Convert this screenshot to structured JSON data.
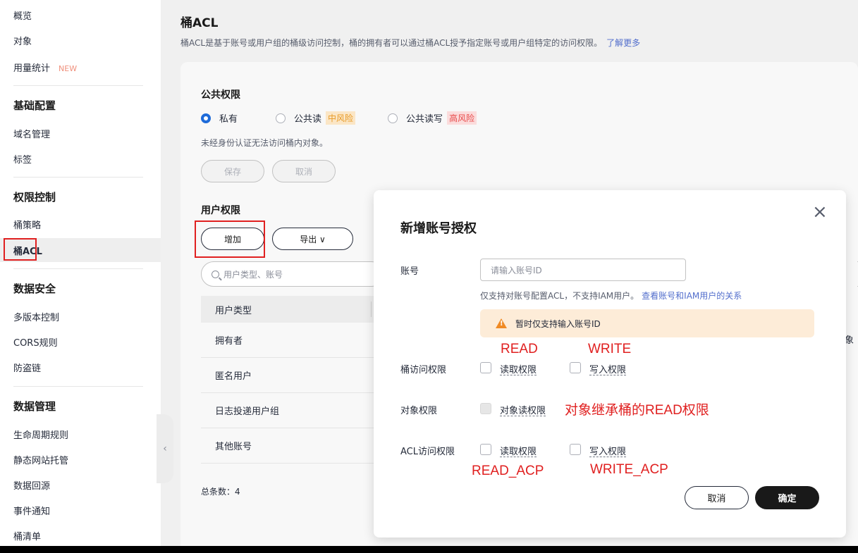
{
  "sidebar": {
    "items": [
      {
        "label": "概览"
      },
      {
        "label": "对象"
      },
      {
        "label": "用量统计",
        "badge": "NEW"
      }
    ],
    "groups": [
      {
        "title": "基础配置",
        "items": [
          "域名管理",
          "标签"
        ]
      },
      {
        "title": "权限控制",
        "items": [
          "桶策略",
          "桶ACL"
        ]
      },
      {
        "title": "数据安全",
        "items": [
          "多版本控制",
          "CORS规则",
          "防盗链"
        ]
      },
      {
        "title": "数据管理",
        "items": [
          "生命周期规则",
          "静态网站托管",
          "数据回源",
          "事件通知",
          "桶清单"
        ]
      }
    ],
    "active_item": "桶ACL",
    "collapse_icon": "‹"
  },
  "main": {
    "title": "桶ACL",
    "description": "桶ACL是基于账号或用户组的桶级访问控制，桶的拥有者可以通过桶ACL授予指定账号或用户组特定的访问权限。",
    "learn_more": "了解更多",
    "public": {
      "title": "公共权限",
      "options": [
        {
          "label": "私有",
          "checked": true
        },
        {
          "label": "公共读",
          "risk": "中风险"
        },
        {
          "label": "公共读写",
          "risk": "高风险"
        }
      ],
      "hint": "未经身份认证无法访问桶内对象。",
      "save_label": "保存",
      "cancel_label": "取消"
    },
    "user": {
      "title": "用户权限",
      "add_label": "增加",
      "export_label": "导出 ∨",
      "search_placeholder": "用户类型、账号",
      "column_header": "用户类型",
      "rows": [
        "拥有者",
        "匿名用户",
        "日志投递用户组",
        "其他账号"
      ],
      "right_edge_text": "象",
      "total": "总条数：4"
    }
  },
  "dialog": {
    "title": "新增账号授权",
    "close_icon": "×",
    "account_label": "账号",
    "account_placeholder": "请输入账号ID",
    "note": "仅支持对账号配置ACL，不支持IAM用户。",
    "note_link": "查看账号和IAM用户的关系",
    "warning": "暂时仅支持输入账号ID",
    "bucket_perm_label": "桶访问权限",
    "object_perm_label": "对象权限",
    "acl_perm_label": "ACL访问权限",
    "read_label": "读取权限",
    "write_label": "写入权限",
    "object_read_label": "对象读权限",
    "cancel_label": "取消",
    "ok_label": "确定"
  },
  "annotations": {
    "read": "READ",
    "write": "WRITE",
    "object_inherit": "对象继承桶的READ权限",
    "read_acp": "READ_ACP",
    "write_acp": "WRITE_ACP",
    "color": "#e02020"
  }
}
